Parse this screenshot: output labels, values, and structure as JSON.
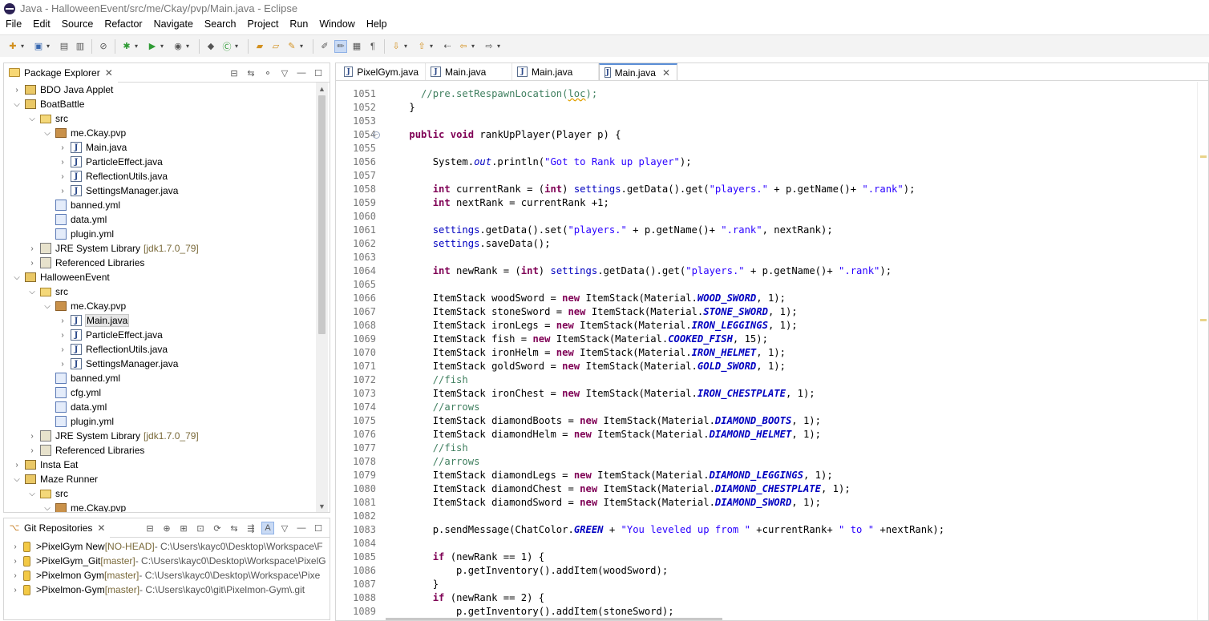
{
  "window": {
    "title": "Java - HalloweenEvent/src/me/Ckay/pvp/Main.java - Eclipse"
  },
  "menu": [
    "File",
    "Edit",
    "Source",
    "Refactor",
    "Navigate",
    "Search",
    "Project",
    "Run",
    "Window",
    "Help"
  ],
  "package_explorer": {
    "title": "Package Explorer",
    "rows": [
      {
        "depth": 0,
        "twisty": "›",
        "icon": "project",
        "label": "BDO Java Applet",
        "deco": ""
      },
      {
        "depth": 0,
        "twisty": "⌄",
        "icon": "project",
        "label": "BoatBattle",
        "deco": ""
      },
      {
        "depth": 1,
        "twisty": "⌄",
        "icon": "src",
        "label": "src",
        "deco": ""
      },
      {
        "depth": 2,
        "twisty": "⌄",
        "icon": "pkg",
        "label": "me.Ckay.pvp",
        "deco": ""
      },
      {
        "depth": 3,
        "twisty": "›",
        "icon": "java",
        "label": "Main.java",
        "deco": ""
      },
      {
        "depth": 3,
        "twisty": "›",
        "icon": "java",
        "label": "ParticleEffect.java",
        "deco": ""
      },
      {
        "depth": 3,
        "twisty": "›",
        "icon": "java",
        "label": "ReflectionUtils.java",
        "deco": ""
      },
      {
        "depth": 3,
        "twisty": "›",
        "icon": "java",
        "label": "SettingsManager.java",
        "deco": ""
      },
      {
        "depth": 2,
        "twisty": "",
        "icon": "yml",
        "label": "banned.yml",
        "deco": ""
      },
      {
        "depth": 2,
        "twisty": "",
        "icon": "yml",
        "label": "data.yml",
        "deco": ""
      },
      {
        "depth": 2,
        "twisty": "",
        "icon": "yml",
        "label": "plugin.yml",
        "deco": ""
      },
      {
        "depth": 1,
        "twisty": "›",
        "icon": "lib",
        "label": "JRE System Library",
        "deco": "[jdk1.7.0_79]"
      },
      {
        "depth": 1,
        "twisty": "›",
        "icon": "lib",
        "label": "Referenced Libraries",
        "deco": ""
      },
      {
        "depth": 0,
        "twisty": "⌄",
        "icon": "project",
        "label": "HalloweenEvent",
        "deco": ""
      },
      {
        "depth": 1,
        "twisty": "⌄",
        "icon": "src",
        "label": "src",
        "deco": ""
      },
      {
        "depth": 2,
        "twisty": "⌄",
        "icon": "pkg",
        "label": "me.Ckay.pvp",
        "deco": ""
      },
      {
        "depth": 3,
        "twisty": "›",
        "icon": "java",
        "label": "Main.java",
        "deco": "",
        "selected": true
      },
      {
        "depth": 3,
        "twisty": "›",
        "icon": "java",
        "label": "ParticleEffect.java",
        "deco": ""
      },
      {
        "depth": 3,
        "twisty": "›",
        "icon": "java",
        "label": "ReflectionUtils.java",
        "deco": ""
      },
      {
        "depth": 3,
        "twisty": "›",
        "icon": "java",
        "label": "SettingsManager.java",
        "deco": ""
      },
      {
        "depth": 2,
        "twisty": "",
        "icon": "yml",
        "label": "banned.yml",
        "deco": ""
      },
      {
        "depth": 2,
        "twisty": "",
        "icon": "yml",
        "label": "cfg.yml",
        "deco": ""
      },
      {
        "depth": 2,
        "twisty": "",
        "icon": "yml",
        "label": "data.yml",
        "deco": ""
      },
      {
        "depth": 2,
        "twisty": "",
        "icon": "yml",
        "label": "plugin.yml",
        "deco": ""
      },
      {
        "depth": 1,
        "twisty": "›",
        "icon": "lib",
        "label": "JRE System Library",
        "deco": "[jdk1.7.0_79]"
      },
      {
        "depth": 1,
        "twisty": "›",
        "icon": "lib",
        "label": "Referenced Libraries",
        "deco": ""
      },
      {
        "depth": 0,
        "twisty": "›",
        "icon": "project",
        "label": "Insta Eat",
        "deco": ""
      },
      {
        "depth": 0,
        "twisty": "⌄",
        "icon": "project",
        "label": "Maze Runner",
        "deco": ""
      },
      {
        "depth": 1,
        "twisty": "⌄",
        "icon": "src",
        "label": "src",
        "deco": ""
      },
      {
        "depth": 2,
        "twisty": "⌄",
        "icon": "pkg",
        "label": "me.Ckay.pvp",
        "deco": ""
      }
    ]
  },
  "git_repositories": {
    "title": "Git Repositories",
    "repos": [
      {
        "name": "PixelGym New",
        "branch": "[NO-HEAD]",
        "path": "- C:\\Users\\kayc0\\Desktop\\Workspace\\F"
      },
      {
        "name": "PixelGym_Git",
        "branch": "[master]",
        "path": "- C:\\Users\\kayc0\\Desktop\\Workspace\\PixelG"
      },
      {
        "name": "Pixelmon Gym",
        "branch": "[master]",
        "path": "- C:\\Users\\kayc0\\Desktop\\Workspace\\Pixe"
      },
      {
        "name": "Pixelmon-Gym",
        "branch": "[master]",
        "path": "- C:\\Users\\kayc0\\git\\Pixelmon-Gym\\.git"
      }
    ]
  },
  "editor": {
    "tabs": [
      {
        "label": "PixelGym.java",
        "active": false
      },
      {
        "label": "Main.java",
        "active": false
      },
      {
        "label": "Main.java",
        "active": false
      },
      {
        "label": "Main.java",
        "active": true
      }
    ],
    "lines": [
      {
        "n": "1051",
        "t": [
          [
            "      ",
            ""
          ],
          [
            "//pre.setRespawnLocation(",
            "cm"
          ],
          [
            "loc",
            "cm squig"
          ],
          [
            ");",
            "cm"
          ]
        ]
      },
      {
        "n": "1052",
        "t": [
          [
            "    }",
            ""
          ]
        ]
      },
      {
        "n": "1053",
        "t": [
          [
            "",
            ""
          ]
        ]
      },
      {
        "n": "1054",
        "fold": true,
        "t": [
          [
            "    ",
            ""
          ],
          [
            "public",
            "kw"
          ],
          [
            " ",
            ""
          ],
          [
            "void",
            "kw"
          ],
          [
            " rankUpPlayer(Player p) {",
            ""
          ]
        ]
      },
      {
        "n": "1055",
        "t": [
          [
            "",
            ""
          ]
        ]
      },
      {
        "n": "1056",
        "t": [
          [
            "        System.",
            ""
          ],
          [
            "out",
            "sfld"
          ],
          [
            ".println(",
            ""
          ],
          [
            "\"Got to Rank up player\"",
            "str"
          ],
          [
            ");",
            ""
          ]
        ]
      },
      {
        "n": "1057",
        "t": [
          [
            "",
            ""
          ]
        ]
      },
      {
        "n": "1058",
        "t": [
          [
            "        ",
            ""
          ],
          [
            "int",
            "kw"
          ],
          [
            " currentRank = (",
            ""
          ],
          [
            "int",
            "kw"
          ],
          [
            ") ",
            ""
          ],
          [
            "settings",
            "ofld"
          ],
          [
            ".getData().get(",
            ""
          ],
          [
            "\"players.\"",
            "str"
          ],
          [
            " + p.getName()+ ",
            ""
          ],
          [
            "\".rank\"",
            "str"
          ],
          [
            ");",
            ""
          ]
        ]
      },
      {
        "n": "1059",
        "t": [
          [
            "        ",
            ""
          ],
          [
            "int",
            "kw"
          ],
          [
            " nextRank = currentRank +1;",
            ""
          ]
        ]
      },
      {
        "n": "1060",
        "t": [
          [
            "",
            ""
          ]
        ]
      },
      {
        "n": "1061",
        "t": [
          [
            "        ",
            ""
          ],
          [
            "settings",
            "ofld"
          ],
          [
            ".getData().set(",
            ""
          ],
          [
            "\"players.\"",
            "str"
          ],
          [
            " + p.getName()+ ",
            ""
          ],
          [
            "\".rank\"",
            "str"
          ],
          [
            ", nextRank);",
            ""
          ]
        ]
      },
      {
        "n": "1062",
        "t": [
          [
            "        ",
            ""
          ],
          [
            "settings",
            "ofld"
          ],
          [
            ".saveData();",
            ""
          ]
        ]
      },
      {
        "n": "1063",
        "t": [
          [
            "",
            ""
          ]
        ]
      },
      {
        "n": "1064",
        "t": [
          [
            "        ",
            ""
          ],
          [
            "int",
            "kw"
          ],
          [
            " newRank = (",
            ""
          ],
          [
            "int",
            "kw"
          ],
          [
            ") ",
            ""
          ],
          [
            "settings",
            "ofld"
          ],
          [
            ".getData().get(",
            ""
          ],
          [
            "\"players.\"",
            "str"
          ],
          [
            " + p.getName()+ ",
            ""
          ],
          [
            "\".rank\"",
            "str"
          ],
          [
            ");",
            ""
          ]
        ]
      },
      {
        "n": "1065",
        "t": [
          [
            "",
            ""
          ]
        ]
      },
      {
        "n": "1066",
        "t": [
          [
            "        ItemStack woodSword = ",
            ""
          ],
          [
            "new",
            "kw"
          ],
          [
            " ItemStack(Material.",
            ""
          ],
          [
            "WOOD_SWORD",
            "fld"
          ],
          [
            ", 1);",
            ""
          ]
        ]
      },
      {
        "n": "1067",
        "t": [
          [
            "        ItemStack stoneSword = ",
            ""
          ],
          [
            "new",
            "kw"
          ],
          [
            " ItemStack(Material.",
            ""
          ],
          [
            "STONE_SWORD",
            "fld"
          ],
          [
            ", 1);",
            ""
          ]
        ]
      },
      {
        "n": "1068",
        "t": [
          [
            "        ItemStack ironLegs = ",
            ""
          ],
          [
            "new",
            "kw"
          ],
          [
            " ItemStack(Material.",
            ""
          ],
          [
            "IRON_LEGGINGS",
            "fld"
          ],
          [
            ", 1);",
            ""
          ]
        ]
      },
      {
        "n": "1069",
        "t": [
          [
            "        ItemStack fish = ",
            ""
          ],
          [
            "new",
            "kw"
          ],
          [
            " ItemStack(Material.",
            ""
          ],
          [
            "COOKED_FISH",
            "fld"
          ],
          [
            ", 15);",
            ""
          ]
        ]
      },
      {
        "n": "1070",
        "t": [
          [
            "        ItemStack ironHelm = ",
            ""
          ],
          [
            "new",
            "kw"
          ],
          [
            " ItemStack(Material.",
            ""
          ],
          [
            "IRON_HELMET",
            "fld"
          ],
          [
            ", 1);",
            ""
          ]
        ]
      },
      {
        "n": "1071",
        "t": [
          [
            "        ItemStack goldSword = ",
            ""
          ],
          [
            "new",
            "kw"
          ],
          [
            " ItemStack(Material.",
            ""
          ],
          [
            "GOLD_SWORD",
            "fld"
          ],
          [
            ", 1);",
            ""
          ]
        ]
      },
      {
        "n": "1072",
        "t": [
          [
            "        ",
            ""
          ],
          [
            "//fish",
            "cm"
          ]
        ]
      },
      {
        "n": "1073",
        "t": [
          [
            "        ItemStack ironChest = ",
            ""
          ],
          [
            "new",
            "kw"
          ],
          [
            " ItemStack(Material.",
            ""
          ],
          [
            "IRON_CHESTPLATE",
            "fld"
          ],
          [
            ", 1);",
            ""
          ]
        ]
      },
      {
        "n": "1074",
        "t": [
          [
            "        ",
            ""
          ],
          [
            "//arrows",
            "cm"
          ]
        ]
      },
      {
        "n": "1075",
        "t": [
          [
            "        ItemStack diamondBoots = ",
            ""
          ],
          [
            "new",
            "kw"
          ],
          [
            " ItemStack(Material.",
            ""
          ],
          [
            "DIAMOND_BOOTS",
            "fld"
          ],
          [
            ", 1);",
            ""
          ]
        ]
      },
      {
        "n": "1076",
        "t": [
          [
            "        ItemStack diamondHelm = ",
            ""
          ],
          [
            "new",
            "kw"
          ],
          [
            " ItemStack(Material.",
            ""
          ],
          [
            "DIAMOND_HELMET",
            "fld"
          ],
          [
            ", 1);",
            ""
          ]
        ]
      },
      {
        "n": "1077",
        "t": [
          [
            "        ",
            ""
          ],
          [
            "//fish",
            "cm"
          ]
        ]
      },
      {
        "n": "1078",
        "t": [
          [
            "        ",
            ""
          ],
          [
            "//arrows",
            "cm"
          ]
        ]
      },
      {
        "n": "1079",
        "t": [
          [
            "        ItemStack diamondLegs = ",
            ""
          ],
          [
            "new",
            "kw"
          ],
          [
            " ItemStack(Material.",
            ""
          ],
          [
            "DIAMOND_LEGGINGS",
            "fld"
          ],
          [
            ", 1);",
            ""
          ]
        ]
      },
      {
        "n": "1080",
        "t": [
          [
            "        ItemStack diamondChest = ",
            ""
          ],
          [
            "new",
            "kw"
          ],
          [
            " ItemStack(Material.",
            ""
          ],
          [
            "DIAMOND_CHESTPLATE",
            "fld"
          ],
          [
            ", 1);",
            ""
          ]
        ]
      },
      {
        "n": "1081",
        "t": [
          [
            "        ItemStack diamondSword = ",
            ""
          ],
          [
            "new",
            "kw"
          ],
          [
            " ItemStack(Material.",
            ""
          ],
          [
            "DIAMOND_SWORD",
            "fld"
          ],
          [
            ", 1);",
            ""
          ]
        ]
      },
      {
        "n": "1082",
        "t": [
          [
            "",
            ""
          ]
        ]
      },
      {
        "n": "1083",
        "t": [
          [
            "        p.sendMessage(ChatColor.",
            ""
          ],
          [
            "GREEN",
            "fld"
          ],
          [
            " + ",
            ""
          ],
          [
            "\"You leveled up from \"",
            "str"
          ],
          [
            " +currentRank+ ",
            ""
          ],
          [
            "\" to \"",
            "str"
          ],
          [
            " +nextRank);",
            ""
          ]
        ]
      },
      {
        "n": "1084",
        "t": [
          [
            "",
            ""
          ]
        ]
      },
      {
        "n": "1085",
        "t": [
          [
            "        ",
            ""
          ],
          [
            "if",
            "kw"
          ],
          [
            " (newRank == 1) {",
            ""
          ]
        ]
      },
      {
        "n": "1086",
        "t": [
          [
            "            p.getInventory().addItem(woodSword);",
            ""
          ]
        ]
      },
      {
        "n": "1087",
        "t": [
          [
            "        }",
            ""
          ]
        ]
      },
      {
        "n": "1088",
        "t": [
          [
            "        ",
            ""
          ],
          [
            "if",
            "kw"
          ],
          [
            " (newRank == 2) {",
            ""
          ]
        ]
      },
      {
        "n": "1089",
        "t": [
          [
            "            p.getInventory().addItem(stoneSword);",
            ""
          ]
        ]
      }
    ]
  }
}
